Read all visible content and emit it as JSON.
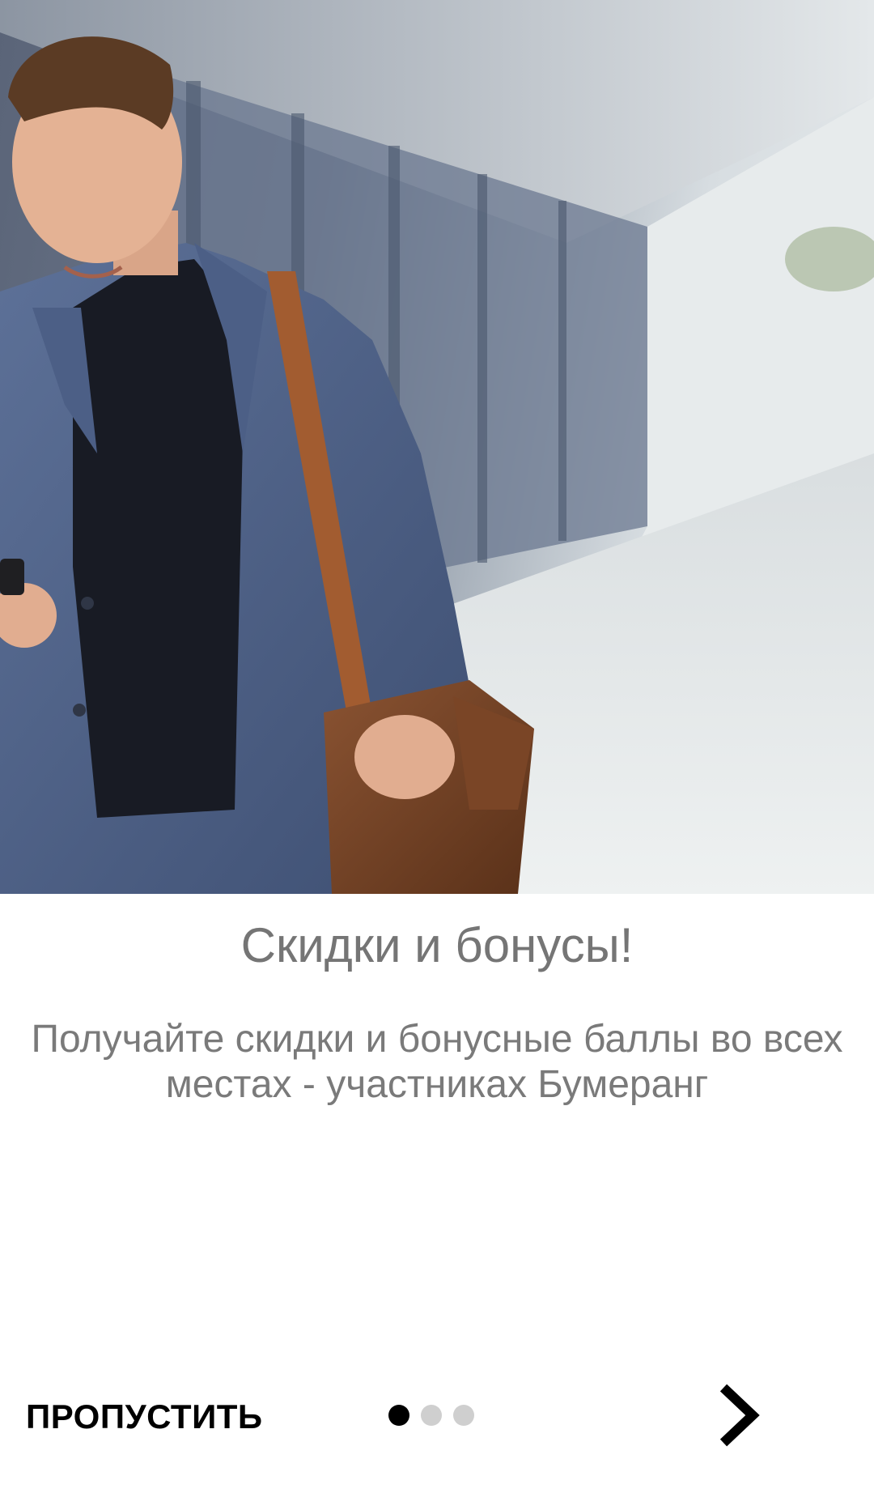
{
  "onboarding": {
    "title": "Скидки и бонусы!",
    "description": "Получайте скидки и бонусные баллы во всех местах - участниках Бумеранг"
  },
  "footer": {
    "skip_label": "ПРОПУСТИТЬ",
    "pager": {
      "current_page": 1,
      "total_pages": 3
    },
    "next_icon": "chevron-right-icon"
  },
  "colors": {
    "title_text": "#757575",
    "body_text": "#7a7a7a",
    "dot_active": "#000000",
    "dot_inactive": "#cfcfcf"
  }
}
